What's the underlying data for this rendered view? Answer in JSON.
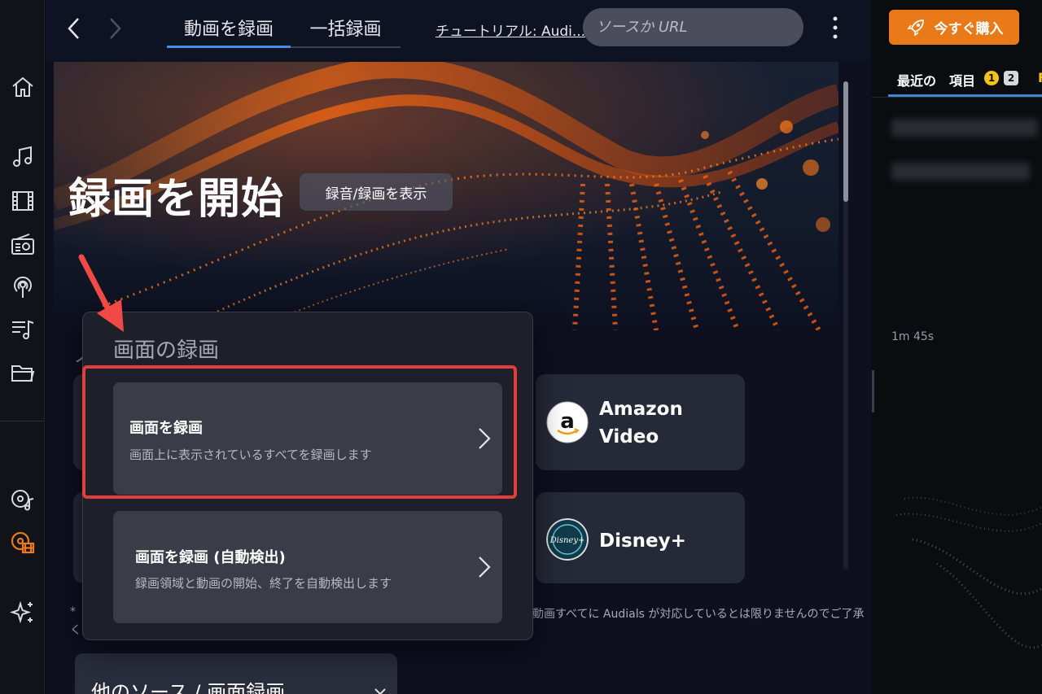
{
  "topbar": {
    "tabs": [
      {
        "label": "動画を録画",
        "active": true
      },
      {
        "label": "一括録画",
        "active": false
      }
    ],
    "tutorial_link": "チュートリアル: Audi...",
    "url_placeholder": "ソースか URL"
  },
  "hero": {
    "title": "録画を開始",
    "button_label": "録音/録画を表示"
  },
  "services": [
    {
      "name": "Amazon Video",
      "line1": "Amazon",
      "line2": "Video",
      "icon": "amazon-logo-icon"
    },
    {
      "name": "Disney+",
      "line1": "Disney+",
      "icon": "disney-plus-logo-icon"
    }
  ],
  "section_partial": "ノ",
  "note": {
    "left1": "*",
    "left2": "く",
    "right": "動画すべてに Audials が対応しているとは限りませんのでご了承"
  },
  "other_sources": {
    "label": "他のソース / 画面録画"
  },
  "popup": {
    "title": "画面の録画",
    "options": [
      {
        "title": "画面を録画",
        "description": "画面上に表示されているすべてを録画します",
        "highlighted": true
      },
      {
        "title": "画面を録画 (自動検出)",
        "description": "録画領域と動画の開始、終了を自動検出します",
        "highlighted": false
      }
    ]
  },
  "right_panel": {
    "buy_button": "今すぐ購入",
    "recent_label": "最近の",
    "items_label": "項目",
    "badge_1": "1",
    "badge_2": "2",
    "tab_partial": "F",
    "duration": "1m 45s"
  },
  "colors": {
    "accent_blue": "#4a8de8",
    "buy_orange": "#ea7a17",
    "highlight_red": "#e43d3b",
    "badge_yellow": "#f2c418"
  }
}
